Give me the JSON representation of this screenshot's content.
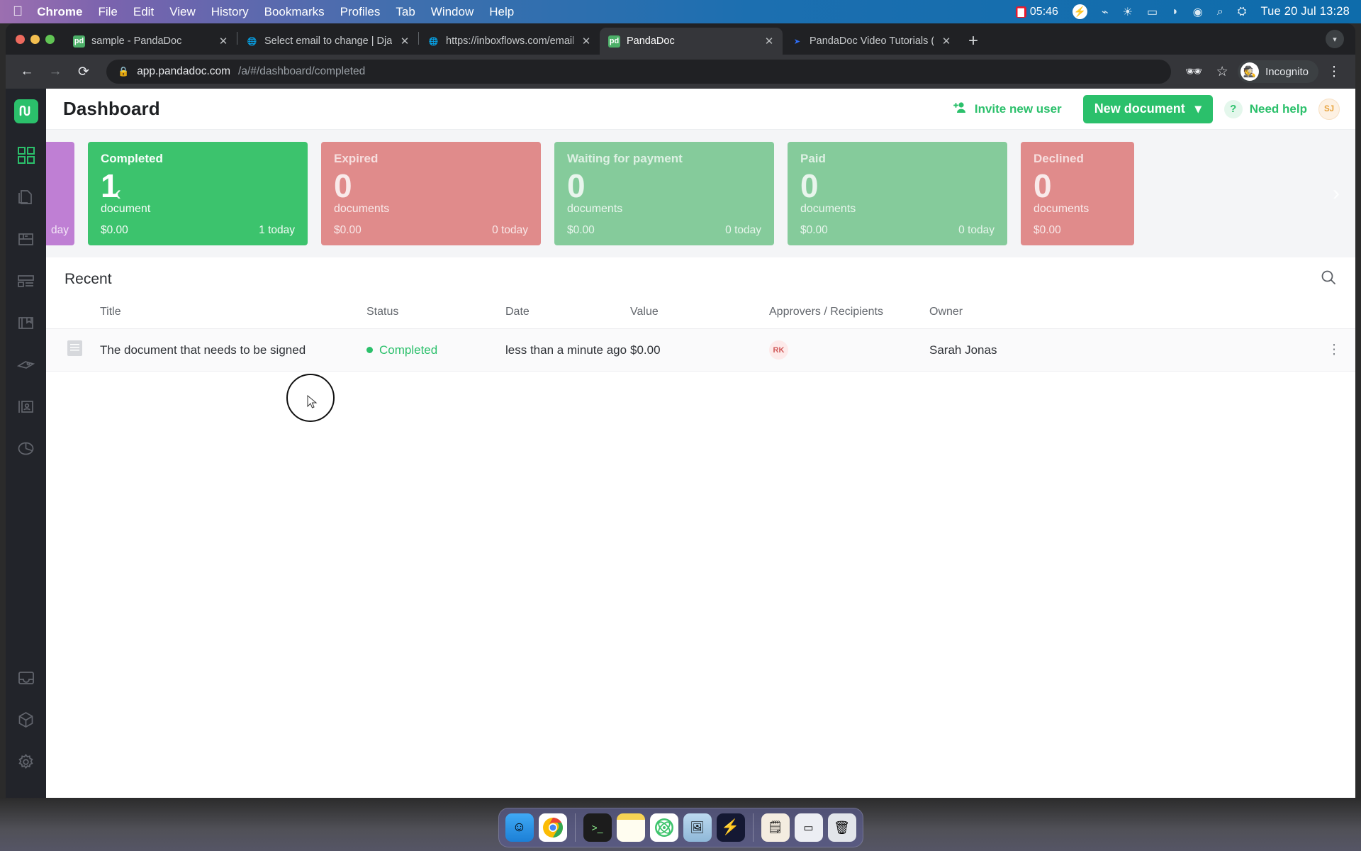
{
  "menubar": {
    "apple_icon": "apple-logo-icon",
    "items": [
      {
        "label": "Chrome",
        "bold": true
      },
      {
        "label": "File",
        "bold": false
      },
      {
        "label": "Edit",
        "bold": false
      },
      {
        "label": "View",
        "bold": false
      },
      {
        "label": "History",
        "bold": false
      },
      {
        "label": "Bookmarks",
        "bold": false
      },
      {
        "label": "Profiles",
        "bold": false
      },
      {
        "label": "Tab",
        "bold": false
      },
      {
        "label": "Window",
        "bold": false
      },
      {
        "label": "Help",
        "bold": false
      }
    ],
    "recording_time": "05:46",
    "status_icons": [
      "bolt-icon",
      "bluetooth-icon",
      "brightness-icon",
      "battery-charging-icon",
      "wifi-icon",
      "user-circle-icon",
      "search-icon",
      "control-center-icon"
    ],
    "clock": "Tue 20 Jul  13:28"
  },
  "browser": {
    "tabs": [
      {
        "title": "sample - PandaDoc",
        "favicon": "pandadoc-icon",
        "active": false
      },
      {
        "title": "Select email to change | Djang",
        "favicon": "globe-icon",
        "active": false
      },
      {
        "title": "https://inboxflows.com/emails/",
        "favicon": "globe-icon",
        "active": false
      },
      {
        "title": "PandaDoc",
        "favicon": "pandadoc-icon",
        "active": true
      },
      {
        "title": "PandaDoc Video Tutorials (Tria",
        "favicon": "video-icon",
        "active": false
      }
    ],
    "new_tab_label": "+",
    "tab_list_icon": "chevron-down-icon",
    "close_label": "✕",
    "nav": {
      "back_icon": "back-arrow-icon",
      "forward_icon": "forward-arrow-icon",
      "reload_icon": "reload-icon"
    },
    "omnibox": {
      "lock_icon": "lock-icon",
      "url_host": "app.pandadoc.com",
      "url_path": "/a/#/dashboard/completed"
    },
    "toolbar_right": {
      "hide_icon": "eye-off-icon",
      "bookmark_icon": "star-icon",
      "profile_label": "Incognito",
      "profile_icon": "incognito-icon",
      "menu_icon": "three-dot-menu-icon"
    }
  },
  "sidebar": {
    "logo": "pandadoc-logo-icon",
    "items": [
      {
        "name": "dashboard",
        "icon": "grid-icon",
        "active": true
      },
      {
        "name": "documents",
        "icon": "documents-icon",
        "active": false
      },
      {
        "name": "templates",
        "icon": "template-icon",
        "active": false
      },
      {
        "name": "content-library",
        "icon": "content-library-icon",
        "active": false
      },
      {
        "name": "catalog",
        "icon": "catalog-icon",
        "active": false
      },
      {
        "name": "pricing",
        "icon": "tag-icon",
        "active": false
      },
      {
        "name": "contacts",
        "icon": "contacts-icon",
        "active": false
      },
      {
        "name": "reports",
        "icon": "pie-chart-icon",
        "active": false
      }
    ],
    "bottom_items": [
      {
        "name": "inbox",
        "icon": "inbox-icon"
      },
      {
        "name": "integrations",
        "icon": "cube-icon"
      },
      {
        "name": "settings",
        "icon": "gear-icon"
      }
    ]
  },
  "header": {
    "title": "Dashboard",
    "invite_label": "Invite new user",
    "invite_icon": "add-user-icon",
    "new_document_label": "New document",
    "new_document_caret": "▾",
    "need_help_label": "Need help",
    "need_help_icon": "question-mark-icon",
    "avatar_initials": "SJ"
  },
  "cards": {
    "arrow_left": "‹",
    "arrow_right": "›",
    "items": [
      {
        "label": "",
        "count": "",
        "unit": "",
        "value": "",
        "today": "day",
        "color": "#bf7fd4",
        "muted": true,
        "peek": "left"
      },
      {
        "label": "Completed",
        "count": "1",
        "unit": "document",
        "value": "$0.00",
        "today": "1 today",
        "color": "#3cc36d",
        "muted": false,
        "peek": "none"
      },
      {
        "label": "Expired",
        "count": "0",
        "unit": "documents",
        "value": "$0.00",
        "today": "0 today",
        "color": "#e08b8b",
        "muted": true,
        "peek": "none"
      },
      {
        "label": "Waiting for payment",
        "count": "0",
        "unit": "documents",
        "value": "$0.00",
        "today": "0 today",
        "color": "#85cb9b",
        "muted": true,
        "peek": "none"
      },
      {
        "label": "Paid",
        "count": "0",
        "unit": "documents",
        "value": "$0.00",
        "today": "0 today",
        "color": "#85cb9b",
        "muted": true,
        "peek": "none"
      },
      {
        "label": "Declined",
        "count": "0",
        "unit": "documents",
        "value": "$0.00",
        "today": "",
        "color": "#e08b8b",
        "muted": true,
        "peek": "right"
      }
    ]
  },
  "recent": {
    "title": "Recent",
    "search_icon": "search-icon",
    "columns": [
      "Title",
      "Status",
      "Date",
      "Value",
      "Approvers / Recipients",
      "Owner"
    ],
    "rows": [
      {
        "doc_icon": "document-icon",
        "title": "The document that needs to be signed",
        "status": "Completed",
        "status_color": "#2bc06b",
        "date": "less than a minute ago",
        "value": "$0.00",
        "recipient_initials": "RK",
        "owner": "Sarah Jonas",
        "menu_icon": "kebab-menu-icon"
      }
    ]
  },
  "dock": {
    "items": [
      {
        "name": "finder",
        "glyph": "🙂",
        "bg": "#4aa3e8",
        "running": true
      },
      {
        "name": "chrome",
        "glyph": "◉",
        "bg": "#ffffff",
        "running": true
      },
      {
        "name": "terminal",
        "glyph": ">_",
        "bg": "#1c1c1c",
        "running": true
      },
      {
        "name": "notes",
        "glyph": "▤",
        "bg": "#fdf3c6",
        "running": true
      },
      {
        "name": "atom",
        "glyph": "⚛",
        "bg": "#ffffff",
        "running": true
      },
      {
        "name": "preview",
        "glyph": "🖼",
        "bg": "#cfe4f5",
        "running": true
      },
      {
        "name": "lightning-app",
        "glyph": "⚡",
        "bg": "#1a1e3a",
        "running": true
      },
      {
        "name": "documents-stack",
        "glyph": "🗒",
        "bg": "#f3e7d2",
        "running": false
      },
      {
        "name": "downloads",
        "glyph": "▭",
        "bg": "#e7e9ef",
        "running": false
      },
      {
        "name": "trash",
        "glyph": "🗑",
        "bg": "#dfe2e8",
        "running": false
      }
    ]
  }
}
